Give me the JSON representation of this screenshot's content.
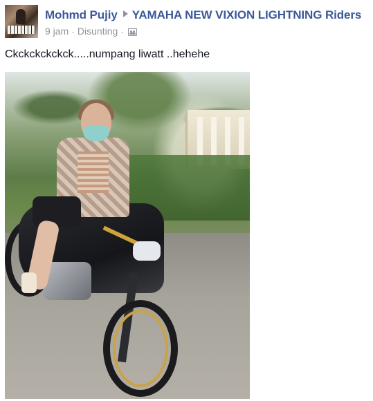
{
  "post": {
    "author": "Mohmd Pujiy",
    "group": "YAMAHA NEW VIXION LIGHTNING Riders",
    "time": "9 jam",
    "separator": "·",
    "edited": "Disunting",
    "text": "Ckckckckckck.....numpang liwatt ..hehehe",
    "icons": {
      "arrow": "right-triangle-icon",
      "audience": "audience-group-icon"
    },
    "colors": {
      "link": "#3b5998",
      "meta": "#90949c",
      "text": "#141823"
    }
  }
}
